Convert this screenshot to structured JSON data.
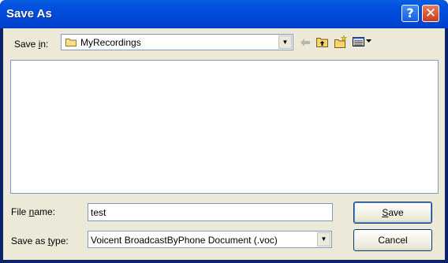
{
  "window": {
    "title": "Save As",
    "help_glyph": "?",
    "close_glyph": "✕"
  },
  "save_in": {
    "label_pre": "Save ",
    "label_accel": "i",
    "label_post": "n:",
    "folder": "MyRecordings",
    "folder_icon": "folder-icon"
  },
  "toolbar": {
    "back_icon": "back-arrow-icon",
    "up_icon": "up-one-level-icon",
    "new_folder_icon": "new-folder-icon",
    "view_menu_icon": "view-menu-icon"
  },
  "file_name": {
    "label_pre": "File ",
    "label_accel": "n",
    "label_post": "ame:",
    "value": "test"
  },
  "save_as_type": {
    "label_pre": "Save as ",
    "label_accel": "t",
    "label_post": "ype:",
    "value": "Voicent BroadcastByPhone Document (.voc)"
  },
  "buttons": {
    "save_accel": "S",
    "save_rest": "ave",
    "cancel": "Cancel"
  },
  "colors": {
    "titlebar": "#0048d8",
    "dialog_face": "#ece9d8",
    "border": "#7f9db9"
  }
}
